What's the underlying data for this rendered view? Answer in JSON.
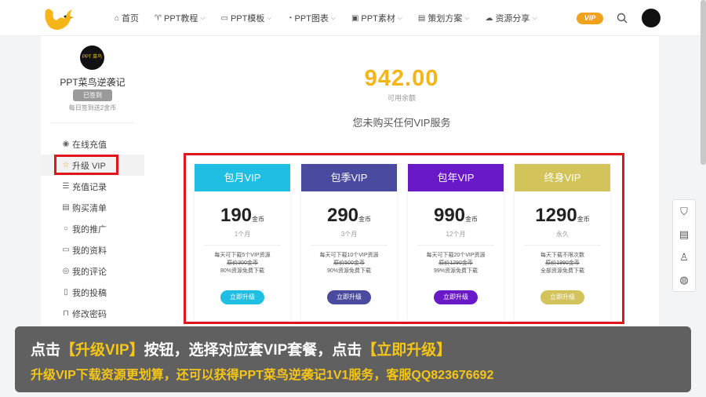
{
  "header": {
    "nav": [
      {
        "label": "首页",
        "icon": "home-icon",
        "dropdown": false
      },
      {
        "label": "PPT教程",
        "icon": "tutorial-icon",
        "dropdown": true
      },
      {
        "label": "PPT模板",
        "icon": "folder-icon",
        "dropdown": true
      },
      {
        "label": "PPT图表",
        "icon": "chart-icon",
        "dropdown": true
      },
      {
        "label": "PPT素材",
        "icon": "image-icon",
        "dropdown": true
      },
      {
        "label": "策划方案",
        "icon": "calendar-icon",
        "dropdown": true
      },
      {
        "label": "资源分享",
        "icon": "cloud-icon",
        "dropdown": true
      }
    ],
    "vip_badge": "VIP"
  },
  "sidebar": {
    "avatar_text": "PPT 菜鸟",
    "username": "PPT菜鸟逆袭记",
    "signed_label": "已签到",
    "sign_tip": "每日签到送2金币",
    "menu": [
      {
        "label": "在线充值",
        "icon": "play-circle-icon",
        "active": false
      },
      {
        "label": "升级 VIP",
        "icon": "star-icon",
        "active": true
      },
      {
        "label": "充值记录",
        "icon": "database-icon",
        "active": false
      },
      {
        "label": "购买清单",
        "icon": "list-icon",
        "active": false
      },
      {
        "label": "我的推广",
        "icon": "circle-icon",
        "active": false
      },
      {
        "label": "我的资料",
        "icon": "id-card-icon",
        "active": false
      },
      {
        "label": "我的评论",
        "icon": "comment-icon",
        "active": false
      },
      {
        "label": "我的投稿",
        "icon": "document-icon",
        "active": false
      },
      {
        "label": "修改密码",
        "icon": "lock-icon",
        "active": false
      }
    ]
  },
  "main": {
    "balance": "942.00",
    "balance_label": "可用余额",
    "no_vip_text": "您未购买任何VIP服务",
    "plans": [
      {
        "name": "包月VIP",
        "price": "190",
        "unit": "金币",
        "period": "1个月",
        "feat1": "每天可下载5个VIP资源",
        "feat2": "原价300金币",
        "feat3": "80%资源免费下载",
        "button": "立即升级",
        "color": "#1fbfe3"
      },
      {
        "name": "包季VIP",
        "price": "290",
        "unit": "金币",
        "period": "3个月",
        "feat1": "每天可下载10个VIP资源",
        "feat2": "原价500金币",
        "feat3": "90%资源免费下载",
        "button": "立即升级",
        "color": "#4a4a9f"
      },
      {
        "name": "包年VIP",
        "price": "990",
        "unit": "金币",
        "period": "12个月",
        "feat1": "每天可下载20个VIP资源",
        "feat2": "原价1290金币",
        "feat3": "99%资源免费下载",
        "button": "立即升级",
        "color": "#6a19c9"
      },
      {
        "name": "终身VIP",
        "price": "1290",
        "unit": "金币",
        "period": "永久",
        "feat1": "每天下载不限次数",
        "feat2": "原价1990金币",
        "feat3": "全部资源免费下载",
        "button": "立即升级",
        "color": "#d2c35a"
      }
    ]
  },
  "float_icons": [
    "basket-icon",
    "calendar-icon",
    "qq-icon",
    "wechat-icon"
  ],
  "caption": {
    "line1_a": "点击",
    "line1_b": "【升级VIP】",
    "line1_c": "按钮，选择对应套VIP套餐，点击",
    "line1_d": "【立即升级】",
    "line2": "升级VIP下载资源更划算，还可以获得PPT菜鸟逆袭记1V1服务，客服QQ823676692"
  },
  "colors": {
    "accent": "#f5b418",
    "highlight": "#e0161d"
  }
}
